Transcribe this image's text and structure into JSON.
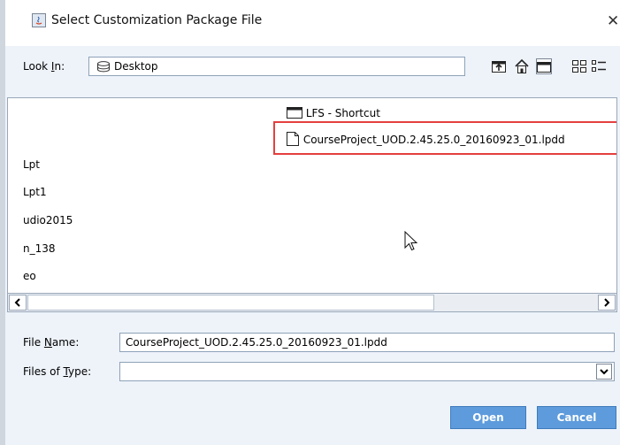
{
  "window": {
    "title": "Select Customization Package File",
    "close_glyph": "✕"
  },
  "look_in": {
    "label_prefix": "Look ",
    "label_mnemonic": "I",
    "label_suffix": "n:",
    "value": "Desktop"
  },
  "files": [
    {
      "name": "LFS - Shortcut",
      "icon": "folder-icon"
    },
    {
      "name": "CourseProject_UOD.2.45.25.0_20160923_01.lpdd",
      "icon": "file-icon",
      "selected": true
    },
    {
      "name": "Lpt",
      "icon": "none"
    },
    {
      "name": "Lpt1",
      "icon": "none"
    },
    {
      "name": "udio2015",
      "icon": "none"
    },
    {
      "name": "n_138",
      "icon": "none"
    },
    {
      "name": "eo",
      "icon": "none"
    }
  ],
  "file_name": {
    "label_prefix": "File ",
    "label_mnemonic": "N",
    "label_suffix": "ame:",
    "value": "CourseProject_UOD.2.45.25.0_20160923_01.lpdd"
  },
  "file_type": {
    "label_prefix": "Files of ",
    "label_mnemonic": "T",
    "label_suffix": "ype:",
    "value": ""
  },
  "buttons": {
    "open": "Open",
    "cancel": "Cancel"
  },
  "colors": {
    "accent": "#5d9bdc",
    "highlight": "#e53f3f"
  }
}
